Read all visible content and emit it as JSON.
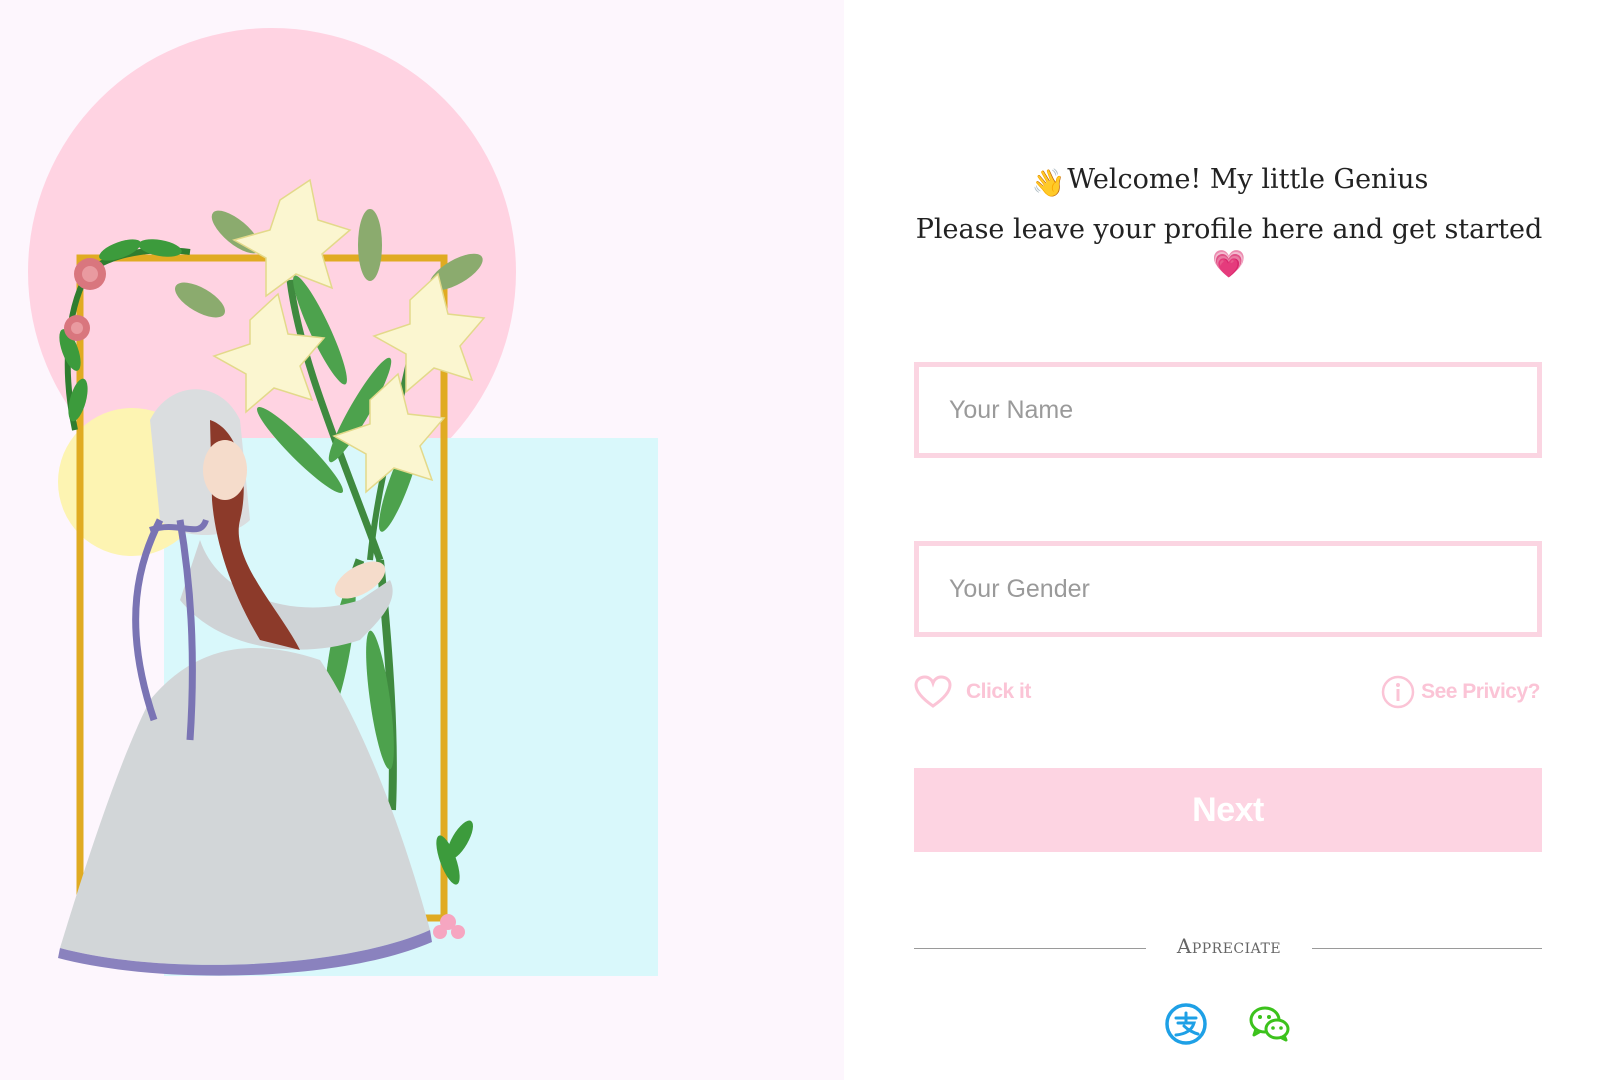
{
  "welcome": {
    "line1_emoji": "👋",
    "line1_text": "Welcome! My little Genius",
    "line2_text": "Please leave your profile here and get started",
    "line2_emoji": "💗"
  },
  "form": {
    "name_placeholder": "Your Name",
    "name_value": "",
    "gender_placeholder": "Your Gender",
    "gender_value": ""
  },
  "links": {
    "click_it": "Click it",
    "see_privacy": "See Privicy?"
  },
  "next_button": "Next",
  "appreciate": "Appreciate",
  "payment_icons": [
    "alipay-icon",
    "wechat-icon"
  ],
  "colors": {
    "left_bg": "#fdf6fd",
    "pink_accent": "#fbd5e2",
    "pink_text": "#fbc4d6",
    "button_bg": "#fdd4e2",
    "alipay_blue": "#1ea0e6",
    "wechat_green": "#3cc21c"
  }
}
